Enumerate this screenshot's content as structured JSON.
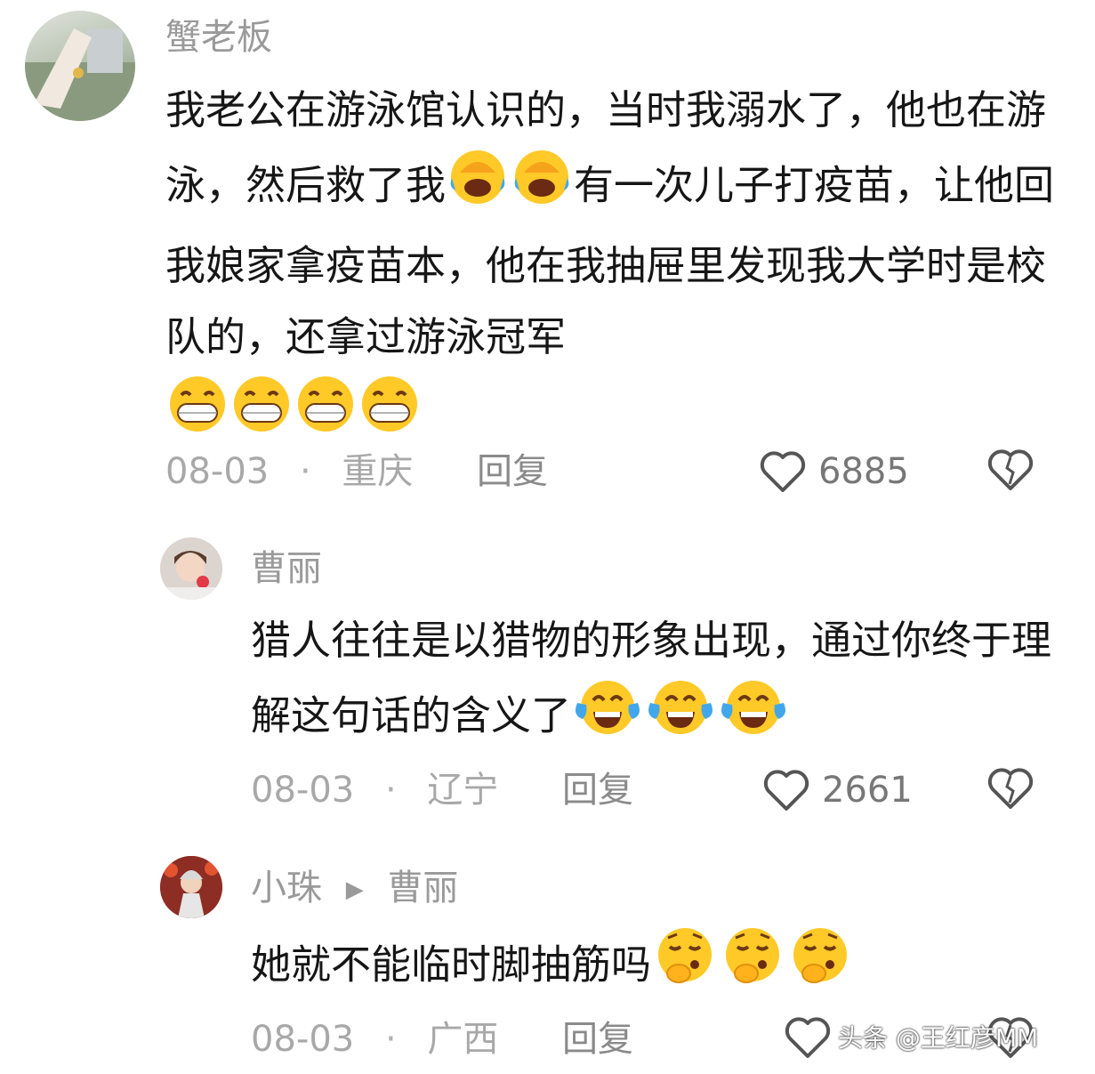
{
  "comments": [
    {
      "user": "蟹老板",
      "text_parts": [
        "我老公在游泳馆认识的，当时我溺水了，他也在游泳，然后救了我",
        "有一次儿子打疫苗，让他回我娘家拿疫苗本，他在我抽屉里发现我大学时是校队的，还拿过游泳冠军"
      ],
      "emoji_mid": "crying-laugh-emoji",
      "emoji_end": "grinning-emoji",
      "date": "08-03",
      "location": "重庆",
      "reply": "回复",
      "likes": "6885"
    },
    {
      "user": "曹丽",
      "text": "猎人往往是以猎物的形象出现，通过你终于理解这句话的含义了",
      "emoji": "tears-of-joy-emoji",
      "date": "08-03",
      "location": "辽宁",
      "reply": "回复",
      "likes": "2661"
    },
    {
      "user": "小珠",
      "reply_to": "曹丽",
      "text": "她就不能临时脚抽筋吗",
      "emoji": "thinking-hand-emoji",
      "date": "08-03",
      "location": "广西",
      "reply": "回复"
    }
  ],
  "separator": "·",
  "reply_arrow": "▶",
  "watermark": "头条 @王红彦MM",
  "colors": {
    "text": "#161616",
    "meta": "#a8a8a8",
    "emoji": "#ffc928"
  }
}
